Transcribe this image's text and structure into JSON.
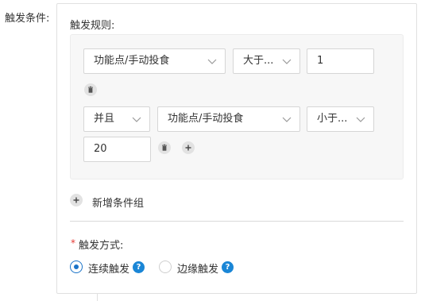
{
  "form": {
    "field_label": "触发条件:",
    "section_title": "触发规则:",
    "row1": {
      "dp_select": "功能点/手动投食",
      "operator_select": "大于...",
      "value_input": "1"
    },
    "row2": {
      "logic_select": "并且",
      "dp_select": "功能点/手动投食",
      "operator_select": "小于...",
      "value_input": "20"
    },
    "add_group_label": "新增条件组",
    "mode": {
      "required_mark": "*",
      "label": "触发方式:",
      "options": [
        {
          "label": "连续触发",
          "checked": true
        },
        {
          "label": "边缘触发",
          "checked": false
        }
      ],
      "help_glyph": "?"
    }
  },
  "colors": {
    "accent": "#1a73c8",
    "help_badge": "#1a86d6",
    "required": "#e53935"
  },
  "icons": [
    "trash-icon",
    "plus-icon",
    "chevron-down-icon",
    "question-icon"
  ]
}
